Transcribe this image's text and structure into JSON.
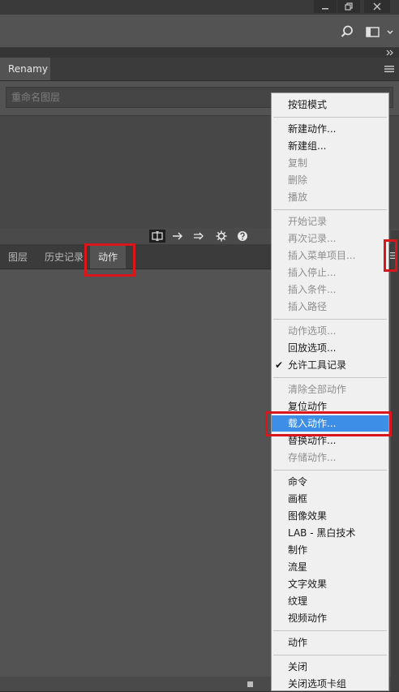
{
  "renamy_panel": {
    "tab_label": "Renamy",
    "input_placeholder": "重命名图层"
  },
  "lower_panel": {
    "tabs": [
      "图层",
      "历史记录",
      "动作"
    ]
  },
  "context_menu": {
    "items": [
      {
        "label": "按钮模式",
        "enabled": true
      },
      {
        "label": "新建动作...",
        "enabled": true
      },
      {
        "label": "新建组...",
        "enabled": true
      },
      {
        "label": "复制",
        "enabled": false
      },
      {
        "label": "删除",
        "enabled": false
      },
      {
        "label": "播放",
        "enabled": false
      },
      {
        "label": "开始记录",
        "enabled": false
      },
      {
        "label": "再次记录...",
        "enabled": false
      },
      {
        "label": "插入菜单项目...",
        "enabled": false
      },
      {
        "label": "插入停止...",
        "enabled": false
      },
      {
        "label": "插入条件...",
        "enabled": false
      },
      {
        "label": "插入路径",
        "enabled": false
      },
      {
        "label": "动作选项...",
        "enabled": false
      },
      {
        "label": "回放选项...",
        "enabled": true
      },
      {
        "label": "允许工具记录",
        "enabled": true,
        "checked": true,
        "check_mark": "✔"
      },
      {
        "label": "清除全部动作",
        "enabled": false
      },
      {
        "label": "复位动作",
        "enabled": true
      },
      {
        "label": "载入动作...",
        "enabled": true,
        "highlighted": true
      },
      {
        "label": "替换动作...",
        "enabled": true
      },
      {
        "label": "存储动作...",
        "enabled": false
      },
      {
        "label": "命令",
        "enabled": true
      },
      {
        "label": "画框",
        "enabled": true
      },
      {
        "label": "图像效果",
        "enabled": true
      },
      {
        "label": "LAB - 黑白技术",
        "enabled": true
      },
      {
        "label": "制作",
        "enabled": true
      },
      {
        "label": "流星",
        "enabled": true
      },
      {
        "label": "文字效果",
        "enabled": true
      },
      {
        "label": "纹理",
        "enabled": true
      },
      {
        "label": "视频动作",
        "enabled": true
      },
      {
        "label": "动作",
        "enabled": true
      },
      {
        "label": "关闭",
        "enabled": true
      },
      {
        "label": "关闭选项卡组",
        "enabled": true
      }
    ]
  },
  "colors": {
    "highlight": "#3d8ee6",
    "annotation_red": "#d8161c"
  }
}
